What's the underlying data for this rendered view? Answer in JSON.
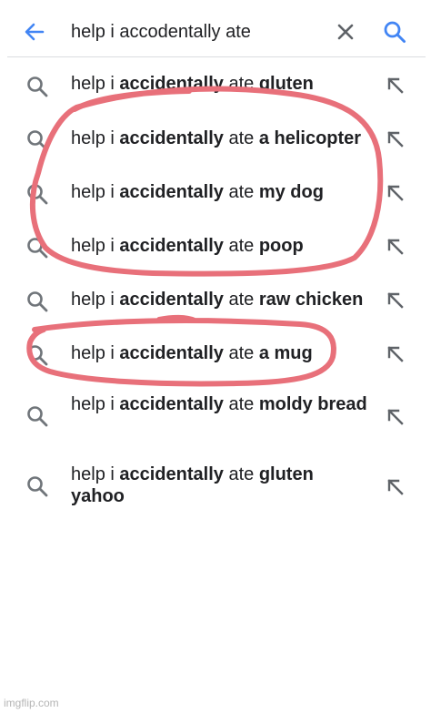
{
  "search": {
    "query": "help i accodentally ate",
    "back_icon": "arrow-left-icon",
    "clear_icon": "close-icon",
    "submit_icon": "search-icon",
    "accent_color": "#4285f4"
  },
  "suggestions": [
    {
      "prefix": "help i ",
      "bold1": "accidentally",
      "mid": " ate ",
      "bold2": "gluten"
    },
    {
      "prefix": "help i ",
      "bold1": "accidentally",
      "mid": " ate ",
      "bold2": "a helicopter"
    },
    {
      "prefix": "help i ",
      "bold1": "accidentally",
      "mid": " ate ",
      "bold2": "my dog"
    },
    {
      "prefix": "help i ",
      "bold1": "accidentally",
      "mid": " ate ",
      "bold2": "poop"
    },
    {
      "prefix": "help i ",
      "bold1": "accidentally",
      "mid": " ate ",
      "bold2": "raw chicken"
    },
    {
      "prefix": "help i ",
      "bold1": "accidentally",
      "mid": " ate ",
      "bold2": "a mug"
    },
    {
      "prefix": "help i ",
      "bold1": "accidentally",
      "mid": " ate ",
      "bold2": "moldy bread"
    },
    {
      "prefix": "help i ",
      "bold1": "accidentally",
      "mid": " ate ",
      "bold2": "gluten yahoo"
    }
  ],
  "annotation_color": "#e8707a",
  "watermark": "imgflip.com"
}
